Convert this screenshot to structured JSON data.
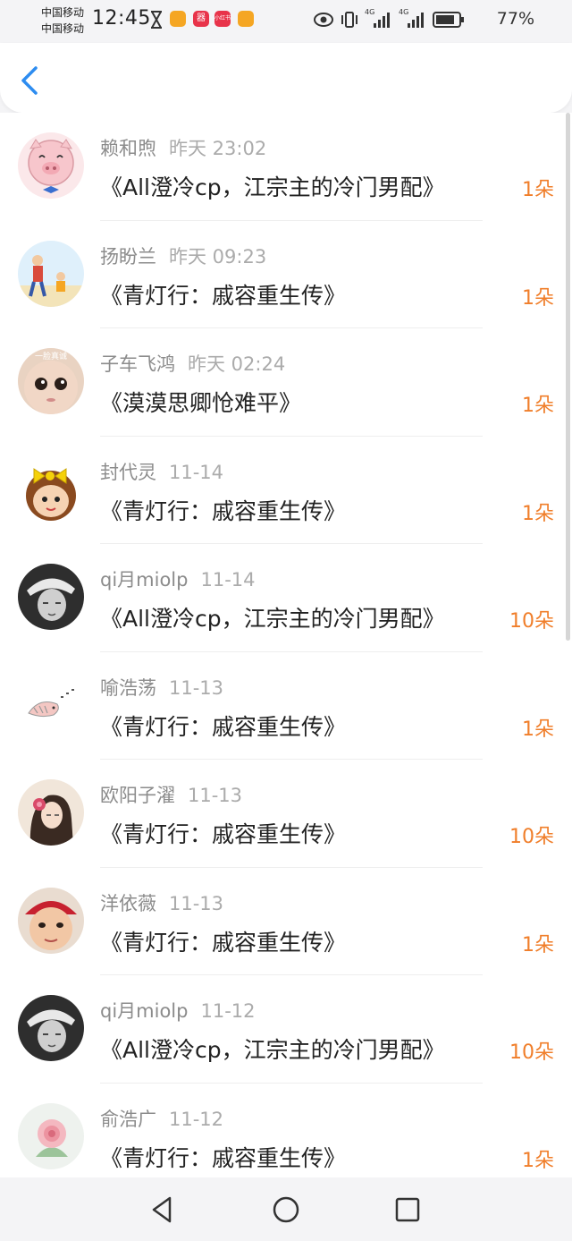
{
  "status_bar": {
    "carrier_1": "中国移动",
    "carrier_2": "中国移动",
    "time": "12:45",
    "network_1": "4G",
    "network_2": "4G",
    "battery": "77%",
    "app_icons": [
      {
        "name": "weibo-icon",
        "color": "#f5a623",
        "text": ""
      },
      {
        "name": "app-red-icon",
        "color": "#e8334a",
        "text": "器"
      },
      {
        "name": "xiaohongshu-icon",
        "color": "#e8334a",
        "text": "小红书"
      },
      {
        "name": "weibo-icon-2",
        "color": "#f5a623",
        "text": ""
      }
    ]
  },
  "header": {
    "back_icon": "chevron-left-icon",
    "accent_color": "#2d8cf0"
  },
  "list": [
    {
      "name": "赖和煦",
      "date": "昨天 23:02",
      "title": "《All澄冷cp，江宗主的冷门男配》",
      "flowers": "1朵",
      "avatar": "pig-avatar"
    },
    {
      "name": "扬盼兰",
      "date": "昨天 09:23",
      "title": "《青灯行：戚容重生传》",
      "flowers": "1朵",
      "avatar": "kids-avatar"
    },
    {
      "name": "子车飞鸿",
      "date": "昨天 02:24",
      "title": "《漠漠思卿怆难平》",
      "flowers": "1朵",
      "avatar": "baby-avatar",
      "avatar_text": "一脸真诚"
    },
    {
      "name": "封代灵",
      "date": "11-14",
      "title": "《青灯行：戚容重生传》",
      "flowers": "1朵",
      "avatar": "cartoon-girl-avatar"
    },
    {
      "name": "qi月miolp",
      "date": "11-14",
      "title": "《All澄冷cp，江宗主的冷门男配》",
      "flowers": "10朵",
      "avatar": "sketch-boy-avatar"
    },
    {
      "name": "喻浩荡",
      "date": "11-13",
      "title": "《青灯行：戚容重生传》",
      "flowers": "1朵",
      "avatar": "seal-avatar"
    },
    {
      "name": "欧阳子濯",
      "date": "11-13",
      "title": "《青灯行：戚容重生传》",
      "flowers": "10朵",
      "avatar": "girl-flower-avatar"
    },
    {
      "name": "洋依薇",
      "date": "11-13",
      "title": "《青灯行：戚容重生传》",
      "flowers": "1朵",
      "avatar": "child-hat-avatar"
    },
    {
      "name": "qi月miolp",
      "date": "11-12",
      "title": "《All澄冷cp，江宗主的冷门男配》",
      "flowers": "10朵",
      "avatar": "sketch-boy-avatar"
    },
    {
      "name": "俞浩广",
      "date": "11-12",
      "title": "《青灯行：戚容重生传》",
      "flowers": "1朵",
      "avatar": "rose-avatar"
    }
  ],
  "navbar": {
    "back": "nav-back-icon",
    "home": "nav-home-icon",
    "recents": "nav-recents-icon"
  }
}
